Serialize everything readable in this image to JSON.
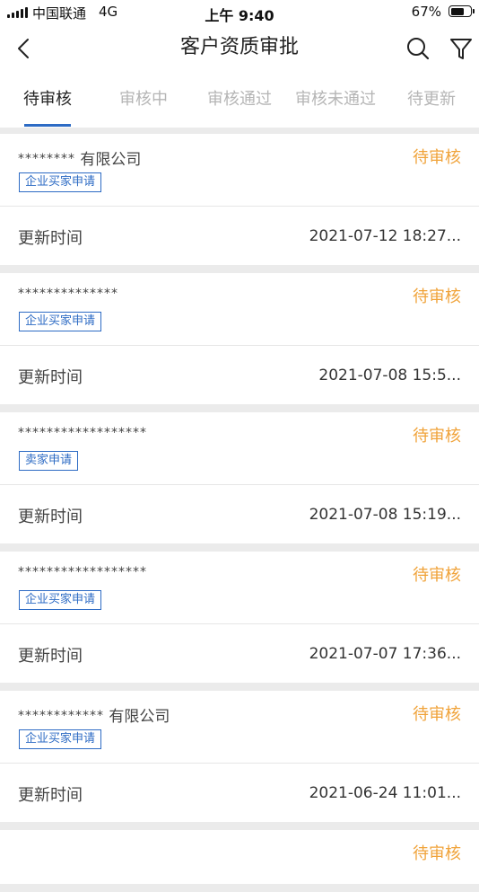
{
  "status_bar": {
    "carrier": "中国联通",
    "network": "4G",
    "time": "上午 9:40",
    "battery": "67%",
    "battery_level": 0.67
  },
  "header": {
    "title": "客户资质审批",
    "back_icon": "chevron-left-icon",
    "search_icon": "search-icon",
    "filter_icon": "filter-icon"
  },
  "tabs": [
    {
      "label": "待审核",
      "active": true
    },
    {
      "label": "审核中",
      "active": false
    },
    {
      "label": "审核通过",
      "active": false
    },
    {
      "label": "审核未通过",
      "active": false
    },
    {
      "label": "待更新",
      "active": false
    }
  ],
  "colors": {
    "accent": "#2d6bc4",
    "pending": "#f0a33a"
  },
  "time_label": "更新时间",
  "items": [
    {
      "mask": "********",
      "suffix": " 有限公司",
      "status": "待审核",
      "type": "企业买家申请",
      "updated": "2021-07-12 18:27..."
    },
    {
      "mask": "**************",
      "suffix": "",
      "status": "待审核",
      "type": "企业买家申请",
      "updated": "2021-07-08 15:5..."
    },
    {
      "mask": "******************",
      "suffix": "",
      "status": "待审核",
      "type": "卖家申请",
      "updated": "2021-07-08 15:19..."
    },
    {
      "mask": "******************",
      "suffix": "",
      "status": "待审核",
      "type": "企业买家申请",
      "updated": "2021-07-07 17:36..."
    },
    {
      "mask": "************",
      "suffix": " 有限公司",
      "status": "待审核",
      "type": "企业买家申请",
      "updated": "2021-06-24 11:01..."
    },
    {
      "status": "待审核"
    }
  ]
}
